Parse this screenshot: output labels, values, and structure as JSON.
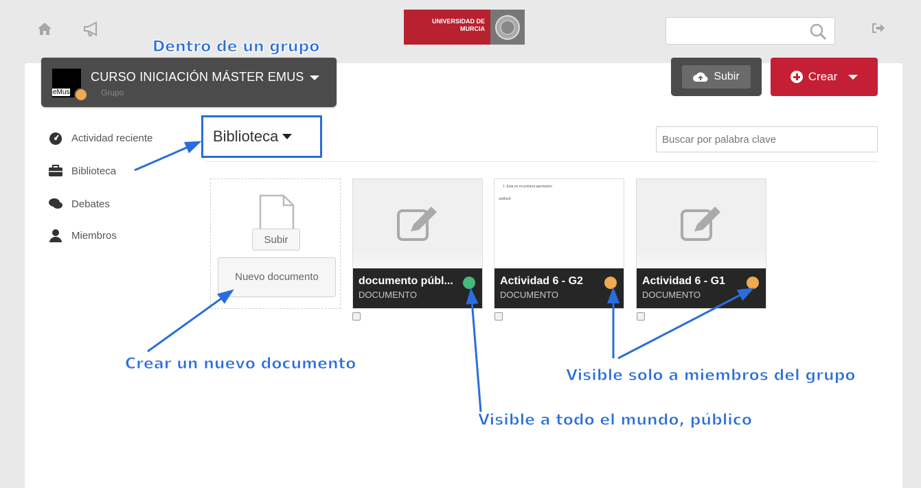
{
  "header": {
    "home_icon": "home-icon",
    "announce_icon": "megaphone-icon",
    "logo": {
      "line1": "UNIVERSIDAD DE",
      "line2": "MURCIA"
    },
    "search_placeholder": "",
    "logout_icon": "logout-icon"
  },
  "group": {
    "title": "CURSO INICIACIÓN MÁSTER EMUS",
    "subtitle": "Grupo",
    "thumb_text": "eMus"
  },
  "actions": {
    "upload_label": "Subir",
    "create_label": "Crear"
  },
  "sidebar": {
    "items": [
      {
        "label": "Actividad reciente",
        "icon": "dashboard-icon"
      },
      {
        "label": "Biblioteca",
        "icon": "briefcase-icon"
      },
      {
        "label": "Debates",
        "icon": "chat-bubbles-icon"
      },
      {
        "label": "Miembros",
        "icon": "user-icon"
      }
    ]
  },
  "library": {
    "section_label": "Biblioteca",
    "search_placeholder": "Buscar por palabra clave",
    "new_card": {
      "upload_label": "Subir",
      "new_doc_label": "Nuevo documento"
    },
    "documents": [
      {
        "title": "documento públ...",
        "type": "DOCUMENTO",
        "visibility": "public"
      },
      {
        "title": "Actividad 6 - G2",
        "type": "DOCUMENTO",
        "visibility": "private",
        "preview_line1": "1. Esta es mi primera aportación",
        "preview_line2": "asdfasd"
      },
      {
        "title": "Actividad 6 - G1",
        "type": "DOCUMENTO",
        "visibility": "private"
      }
    ]
  },
  "annotations": {
    "group": "Dentro de un grupo",
    "create": "Crear un nuevo documento",
    "members": "Visible solo a miembros del grupo",
    "public": "Visible a todo el mundo, público"
  },
  "colors": {
    "accent": "#c41f34",
    "annotation": "#2a6ddc",
    "lock": "#f0a94e",
    "public": "#47b77e"
  }
}
